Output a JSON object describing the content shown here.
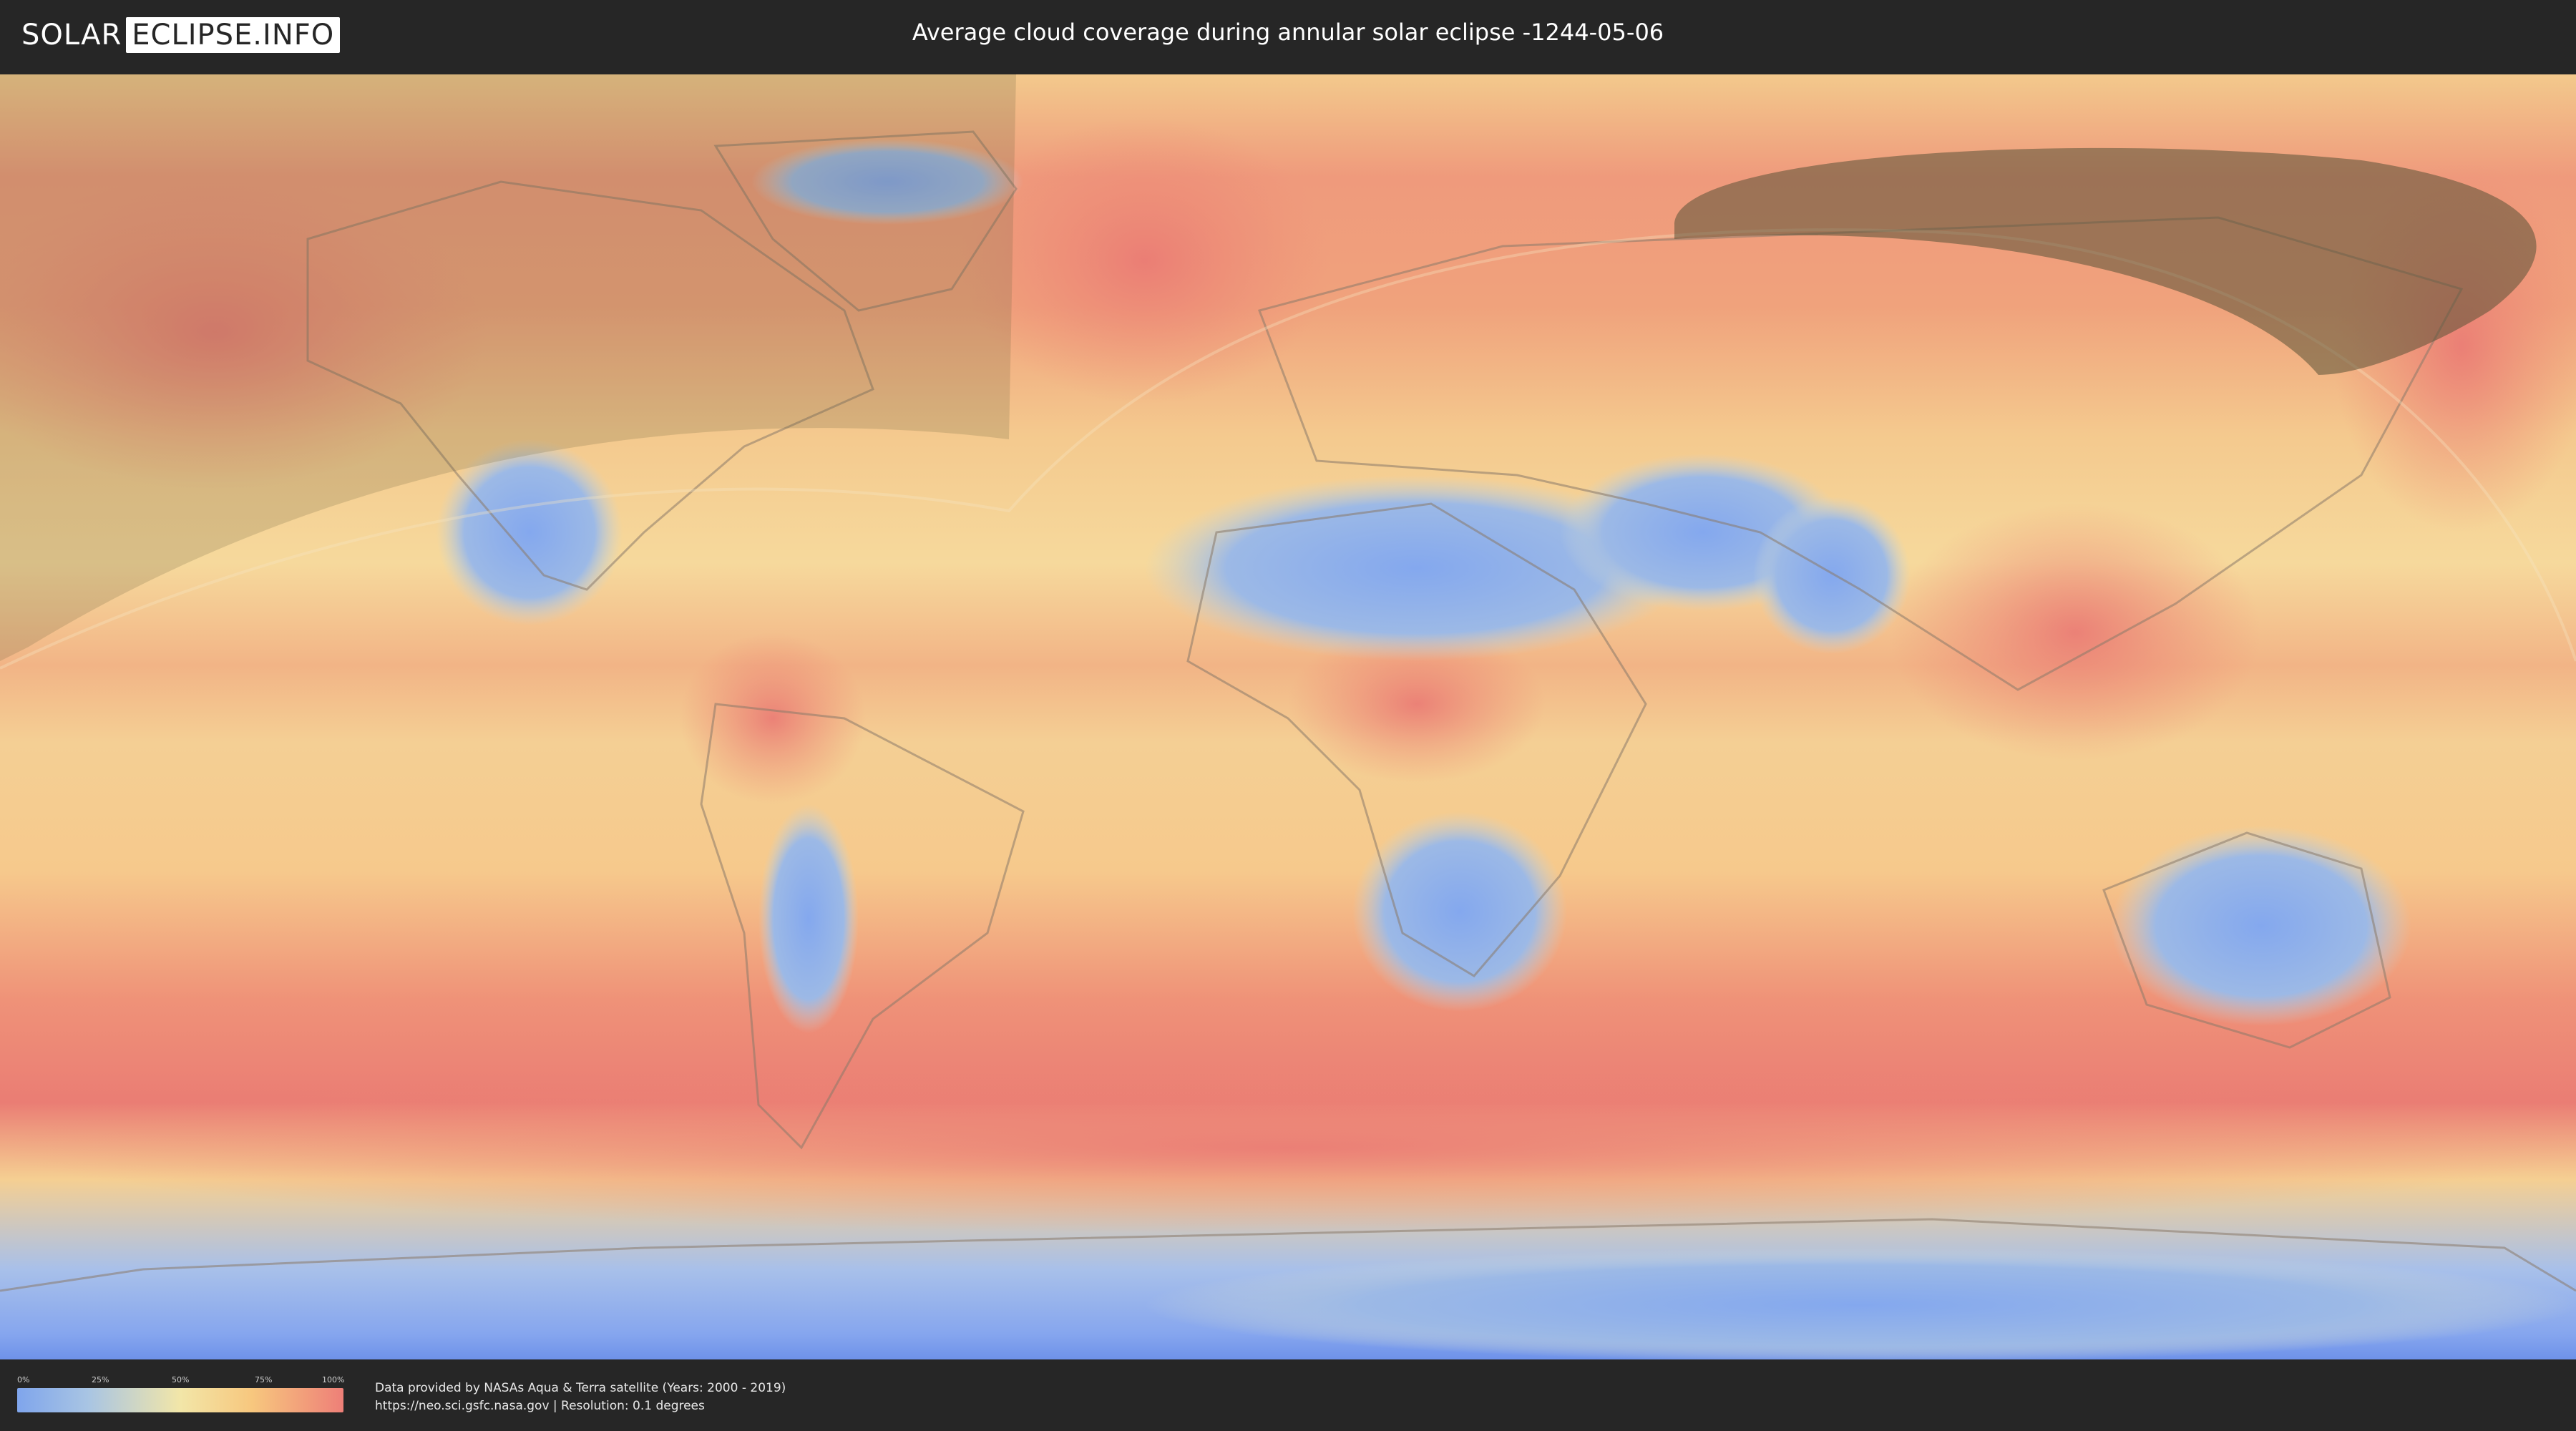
{
  "header": {
    "logo_part1": "SOLAR",
    "logo_part2": "ECLIPSE.INFO",
    "title": "Average cloud coverage during annular solar eclipse -1244-05-06"
  },
  "map": {
    "description_layers": [
      "cloud-coverage",
      "eclipse-visibility-zone",
      "night-shadow"
    ],
    "colors": {
      "clear": "#7fa5ec",
      "mid": "#f2e6a8",
      "cloudy": "#ee7f78",
      "shadow": "#6e6440"
    }
  },
  "legend": {
    "ticks": [
      "0%",
      "25%",
      "50%",
      "75%",
      "100%"
    ]
  },
  "credits": {
    "line1": "Data provided by NASAs Aqua & Terra satellite (Years: 2000 - 2019)",
    "line2": "https://neo.sci.gsfc.nasa.gov | Resolution: 0.1 degrees"
  }
}
